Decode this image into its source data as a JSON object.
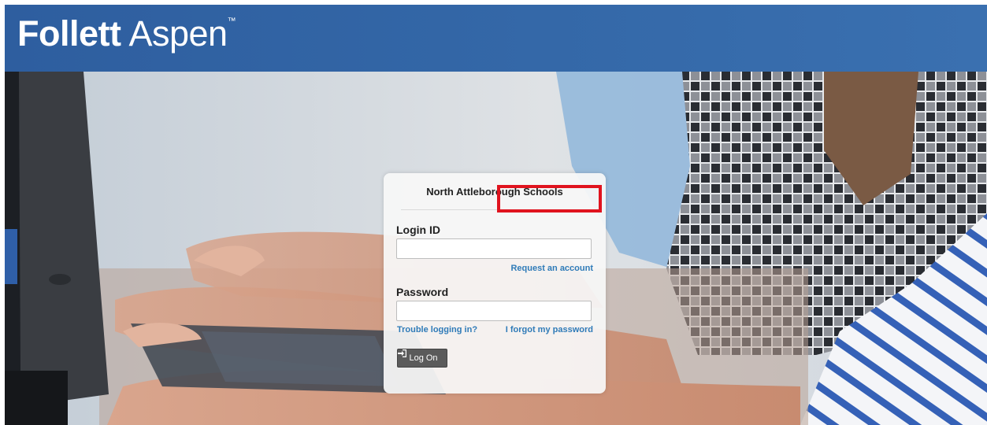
{
  "header": {
    "brand_bold": "Follett",
    "brand_regular": "Aspen",
    "trademark": "™"
  },
  "login": {
    "school_name": "North Attleborough Schools",
    "login_id_label": "Login ID",
    "login_id_value": "",
    "request_account_link": "Request an account",
    "password_label": "Password",
    "password_value": "",
    "trouble_link": "Trouble logging in?",
    "forgot_link": "I forgot my password",
    "logon_button": "Log On",
    "logon_icon": "sign-in-icon"
  },
  "colors": {
    "header_blue": "#3468a8",
    "link_blue": "#2f7bb8",
    "highlight_red": "#e0131e",
    "button_gray": "#5b5b5b"
  }
}
